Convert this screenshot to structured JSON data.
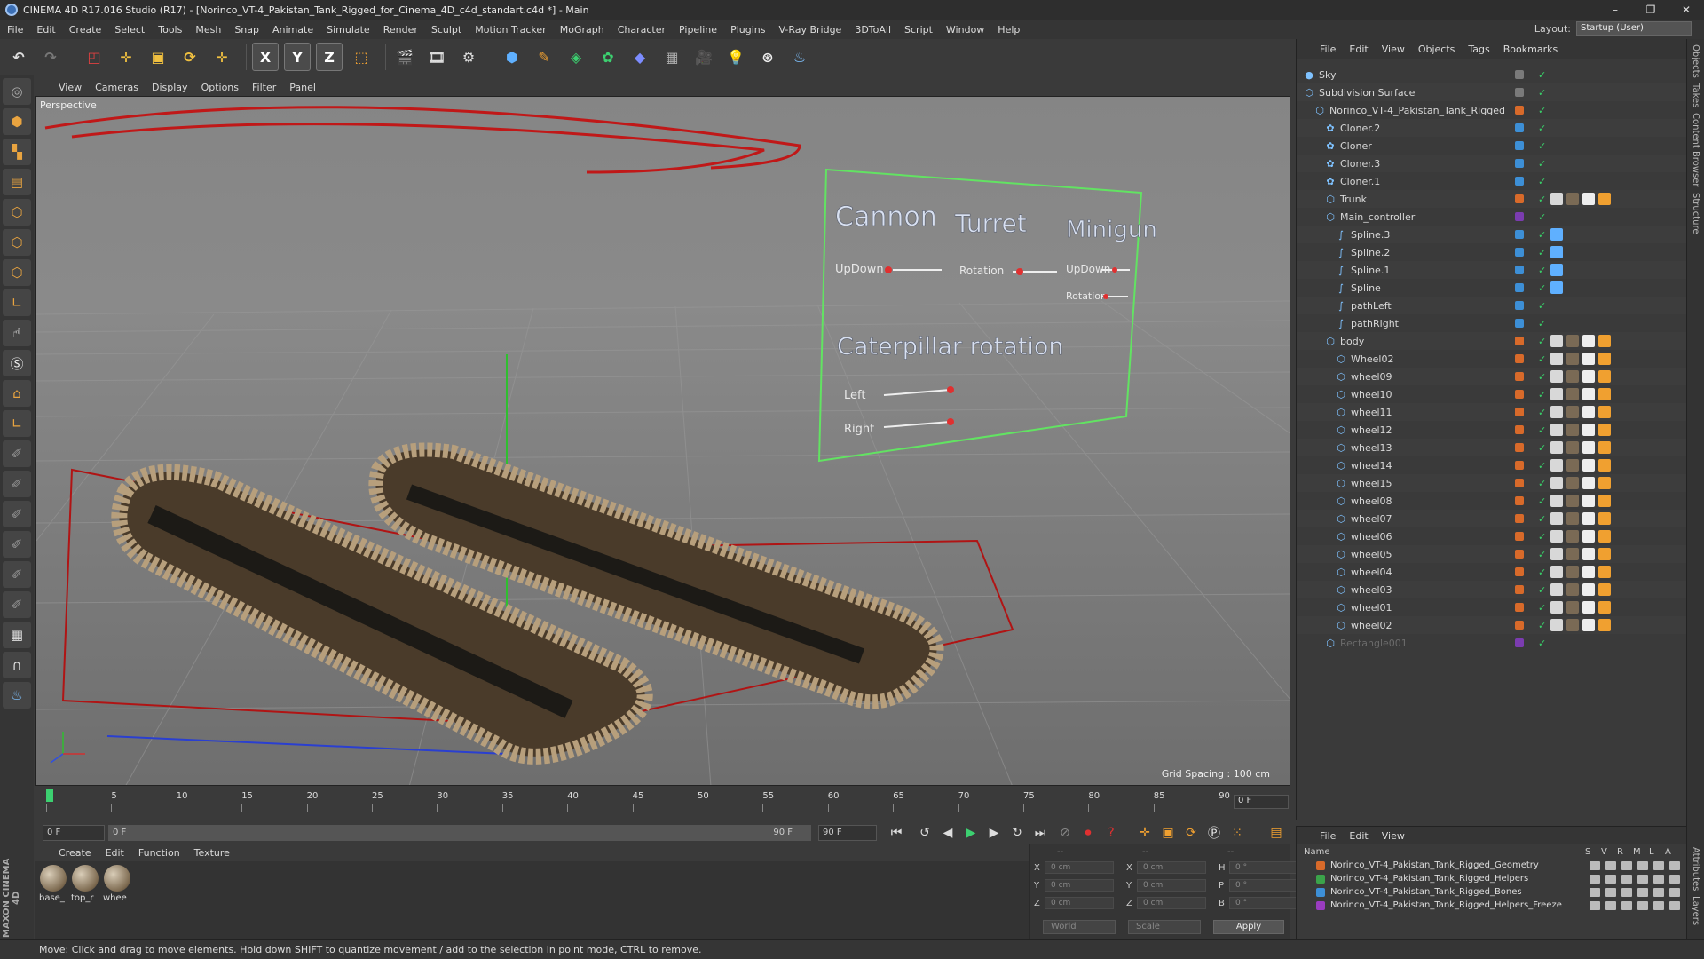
{
  "titlebar": {
    "title": "CINEMA 4D R17.016 Studio (R17) - [Norinco_VT-4_Pakistan_Tank_Rigged_for_Cinema_4D_c4d_standart.c4d *] - Main",
    "minimize": "–",
    "restore": "❐",
    "close": "✕"
  },
  "menubar": {
    "items": [
      "File",
      "Edit",
      "Create",
      "Select",
      "Tools",
      "Mesh",
      "Snap",
      "Animate",
      "Simulate",
      "Render",
      "Sculpt",
      "Motion Tracker",
      "MoGraph",
      "Character",
      "Pipeline",
      "Plugins",
      "V-Ray Bridge",
      "3DToAll",
      "Script",
      "Window",
      "Help"
    ]
  },
  "layout": {
    "label": "Layout:",
    "value": "Startup (User)"
  },
  "toolbar": {
    "axis": [
      "X",
      "Y",
      "Z"
    ]
  },
  "viewport": {
    "menu": [
      "View",
      "Cameras",
      "Display",
      "Options",
      "Filter",
      "Panel"
    ],
    "label": "Perspective",
    "grid_spacing": "Grid Spacing : 100 cm",
    "hud": {
      "cannon": "Cannon",
      "turret": "Turret",
      "minigun": "Minigun",
      "updown1": "UpDown",
      "rotation1": "Rotation",
      "updown2": "UpDown",
      "rotation2": "Rotation",
      "caterpillar": "Caterpillar rotation",
      "left": "Left",
      "right": "Right"
    }
  },
  "timeline": {
    "ticks": [
      "0",
      "5",
      "10",
      "15",
      "20",
      "25",
      "30",
      "35",
      "40",
      "45",
      "50",
      "55",
      "60",
      "65",
      "70",
      "75",
      "80",
      "85",
      "90"
    ],
    "current_frame": "0 F",
    "start_field": "0 F",
    "range_start": "0 F",
    "range_end": "90 F",
    "end_field": "90 F"
  },
  "materials": {
    "menu": [
      "Create",
      "Edit",
      "Function",
      "Texture"
    ],
    "items": [
      "base_",
      "top_r",
      "whee"
    ]
  },
  "coords": {
    "header": [
      "--",
      "--",
      "--"
    ],
    "rows": [
      {
        "l1": "X",
        "v1": "0 cm",
        "l2": "X",
        "v2": "0 cm",
        "l3": "H",
        "v3": "0 °"
      },
      {
        "l1": "Y",
        "v1": "0 cm",
        "l2": "Y",
        "v2": "0 cm",
        "l3": "P",
        "v3": "0 °"
      },
      {
        "l1": "Z",
        "v1": "0 cm",
        "l2": "Z",
        "v2": "0 cm",
        "l3": "B",
        "v3": "0 °"
      }
    ],
    "world": "World",
    "scale": "Scale",
    "apply": "Apply"
  },
  "objects": {
    "menu": [
      "File",
      "Edit",
      "View",
      "Objects",
      "Tags",
      "Bookmarks"
    ],
    "rows": [
      {
        "name": "Sky",
        "indent": 0,
        "color": "#7a7a7a"
      },
      {
        "name": "Subdivision Surface",
        "indent": 0,
        "color": "#7a7a7a"
      },
      {
        "name": "Norinco_VT-4_Pakistan_Tank_Rigged",
        "indent": 1,
        "color": "#d86a2a"
      },
      {
        "name": "Cloner.2",
        "indent": 2,
        "color": "#3d8fd6"
      },
      {
        "name": "Cloner",
        "indent": 2,
        "color": "#3d8fd6"
      },
      {
        "name": "Cloner.3",
        "indent": 2,
        "color": "#3d8fd6"
      },
      {
        "name": "Cloner.1",
        "indent": 2,
        "color": "#3d8fd6"
      },
      {
        "name": "Trunk",
        "indent": 2,
        "color": "#d86a2a"
      },
      {
        "name": "Main_controller",
        "indent": 2,
        "color": "#7b3cb0"
      },
      {
        "name": "Spline.3",
        "indent": 3,
        "color": "#3d8fd6"
      },
      {
        "name": "Spline.2",
        "indent": 3,
        "color": "#3d8fd6"
      },
      {
        "name": "Spline.1",
        "indent": 3,
        "color": "#3d8fd6"
      },
      {
        "name": "Spline",
        "indent": 3,
        "color": "#3d8fd6"
      },
      {
        "name": "pathLeft",
        "indent": 3,
        "color": "#3d8fd6"
      },
      {
        "name": "pathRight",
        "indent": 3,
        "color": "#3d8fd6"
      },
      {
        "name": "body",
        "indent": 2,
        "color": "#d86a2a"
      },
      {
        "name": "Wheel02",
        "indent": 3,
        "color": "#d86a2a"
      },
      {
        "name": "wheel09",
        "indent": 3,
        "color": "#d86a2a"
      },
      {
        "name": "wheel10",
        "indent": 3,
        "color": "#d86a2a"
      },
      {
        "name": "wheel11",
        "indent": 3,
        "color": "#d86a2a"
      },
      {
        "name": "wheel12",
        "indent": 3,
        "color": "#d86a2a"
      },
      {
        "name": "wheel13",
        "indent": 3,
        "color": "#d86a2a"
      },
      {
        "name": "wheel14",
        "indent": 3,
        "color": "#d86a2a"
      },
      {
        "name": "wheel15",
        "indent": 3,
        "color": "#d86a2a"
      },
      {
        "name": "wheel08",
        "indent": 3,
        "color": "#d86a2a"
      },
      {
        "name": "wheel07",
        "indent": 3,
        "color": "#d86a2a"
      },
      {
        "name": "wheel06",
        "indent": 3,
        "color": "#d86a2a"
      },
      {
        "name": "wheel05",
        "indent": 3,
        "color": "#d86a2a"
      },
      {
        "name": "wheel04",
        "indent": 3,
        "color": "#d86a2a"
      },
      {
        "name": "wheel03",
        "indent": 3,
        "color": "#d86a2a"
      },
      {
        "name": "wheel01",
        "indent": 3,
        "color": "#d86a2a"
      },
      {
        "name": "wheel02",
        "indent": 3,
        "color": "#d86a2a"
      },
      {
        "name": "Rectangle001",
        "indent": 2,
        "color": "#7b3cb0"
      }
    ]
  },
  "right_tabs": [
    "Objects",
    "Takes",
    "Content Browser",
    "Structure"
  ],
  "right_tabs_bottom": [
    "Attributes",
    "Layers"
  ],
  "layers": {
    "menu": [
      "File",
      "Edit",
      "View"
    ],
    "head": "Name",
    "flags": [
      "S",
      "V",
      "R",
      "M",
      "L",
      "A"
    ],
    "rows": [
      {
        "name": "Norinco_VT-4_Pakistan_Tank_Rigged_Geometry",
        "color": "#d86a2a"
      },
      {
        "name": "Norinco_VT-4_Pakistan_Tank_Rigged_Helpers",
        "color": "#3ba34a"
      },
      {
        "name": "Norinco_VT-4_Pakistan_Tank_Rigged_Bones",
        "color": "#3d8fd6"
      },
      {
        "name": "Norinco_VT-4_Pakistan_Tank_Rigged_Helpers_Freeze",
        "color": "#9a3cc0"
      }
    ]
  },
  "statusbar": {
    "text": "Move: Click and drag to move elements. Hold down SHIFT to quantize movement / add to the selection in point mode, CTRL to remove."
  },
  "maxon_logo": "MAXON CINEMA 4D"
}
